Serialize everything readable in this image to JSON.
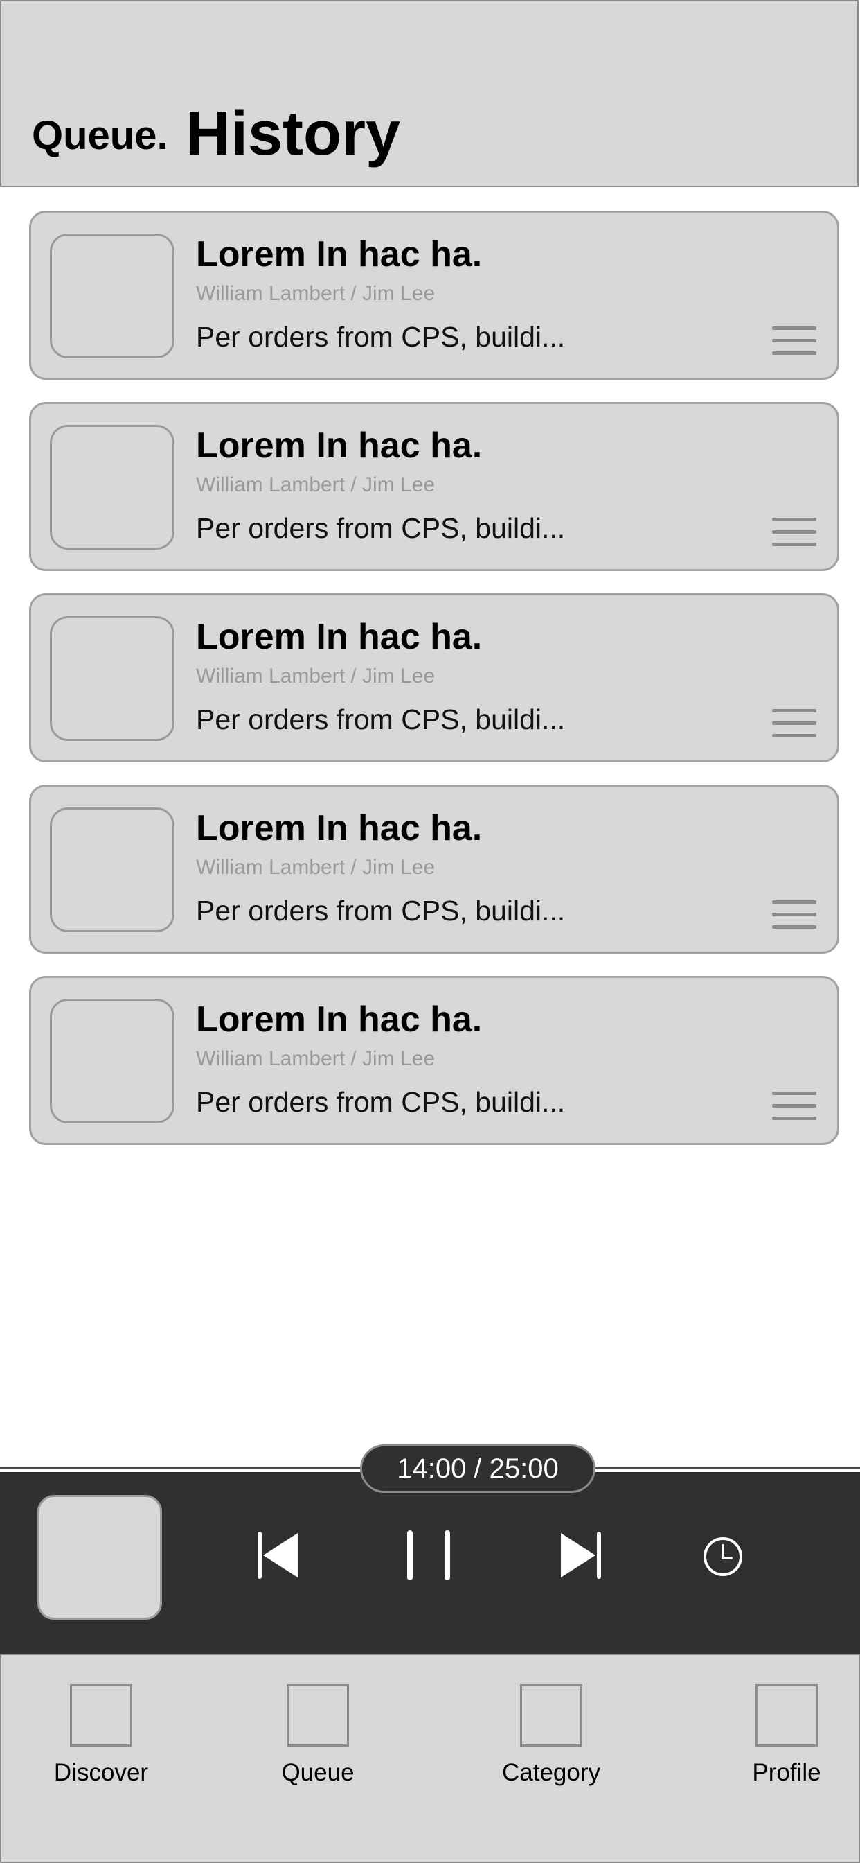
{
  "header": {
    "tab_queue": "Queue.",
    "tab_history": "History"
  },
  "items": [
    {
      "title": "Lorem In hac ha.",
      "subtitle": "William Lambert / Jim Lee",
      "description": "Per orders from CPS, buildi..."
    },
    {
      "title": "Lorem In hac ha.",
      "subtitle": "William Lambert / Jim Lee",
      "description": "Per orders from CPS, buildi..."
    },
    {
      "title": "Lorem In hac ha.",
      "subtitle": "William Lambert / Jim Lee",
      "description": "Per orders from CPS, buildi..."
    },
    {
      "title": "Lorem In hac ha.",
      "subtitle": "William Lambert / Jim Lee",
      "description": "Per orders from CPS, buildi..."
    },
    {
      "title": "Lorem In hac ha.",
      "subtitle": "William Lambert / Jim Lee",
      "description": "Per orders from CPS, buildi..."
    }
  ],
  "player": {
    "time": "14:00 / 25:00",
    "controls": [
      "skip-previous-icon",
      "pause-icon",
      "skip-next-icon",
      "clock-icon"
    ]
  },
  "nav": [
    {
      "label": "Discover"
    },
    {
      "label": "Queue"
    },
    {
      "label": "Category"
    },
    {
      "label": "Profile"
    }
  ],
  "colors": {
    "surface": "#d8d8d8",
    "border": "#8a8a8a",
    "player_bg": "#303030",
    "muted_text": "#9a9a9a"
  }
}
